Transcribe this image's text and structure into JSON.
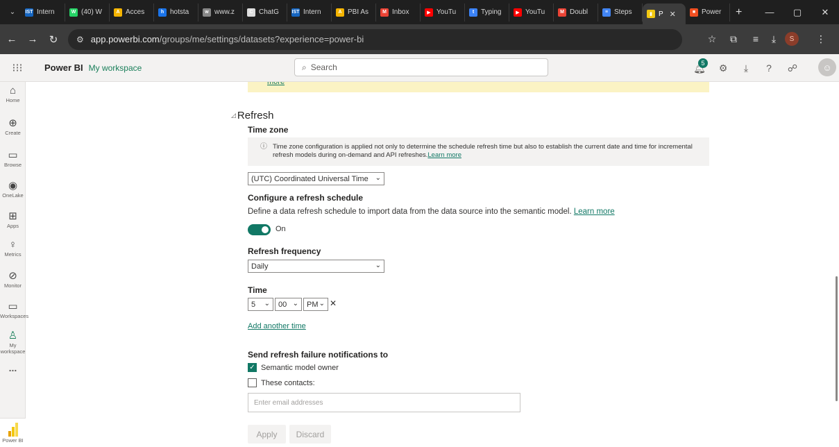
{
  "browser": {
    "tabs": [
      {
        "label": "Intern",
        "color": "#1565c0",
        "glyph": "IST"
      },
      {
        "label": "(40) W",
        "color": "#25d366",
        "glyph": "W"
      },
      {
        "label": "Acces",
        "color": "#f4b400",
        "glyph": "A"
      },
      {
        "label": "hotsta",
        "color": "#1a73e8",
        "glyph": "h"
      },
      {
        "label": "www.z",
        "color": "#888888",
        "glyph": "w"
      },
      {
        "label": "ChatG",
        "color": "#dddddd",
        "glyph": "C"
      },
      {
        "label": "Intern",
        "color": "#1565c0",
        "glyph": "IST"
      },
      {
        "label": "PBI As",
        "color": "#f4b400",
        "glyph": "A"
      },
      {
        "label": "Inbox",
        "color": "#ea4335",
        "glyph": "M"
      },
      {
        "label": "YouTu",
        "color": "#ff0000",
        "glyph": "▶"
      },
      {
        "label": "Typing",
        "color": "#3b82f6",
        "glyph": "t"
      },
      {
        "label": "YouTu",
        "color": "#ff0000",
        "glyph": "▶"
      },
      {
        "label": "Doubl",
        "color": "#ea4335",
        "glyph": "M"
      },
      {
        "label": "Steps",
        "color": "#4285f4",
        "glyph": "≡"
      },
      {
        "label": "P",
        "color": "#f2c811",
        "glyph": "▮",
        "active": true
      },
      {
        "label": "Power",
        "color": "#f25022",
        "glyph": "■"
      }
    ],
    "url_host": "app.powerbi.com",
    "url_path": "/groups/me/settings/datasets?experience=power-bi",
    "profile_initial": "S"
  },
  "header": {
    "brand": "Power BI",
    "workspace": "My workspace",
    "search_placeholder": "Search",
    "notification_count": "5"
  },
  "leftnav": {
    "items": [
      {
        "label": "Home",
        "icon": "home-icon",
        "glyph": "⌂"
      },
      {
        "label": "Create",
        "icon": "create-icon",
        "glyph": "⊕"
      },
      {
        "label": "Browse",
        "icon": "browse-icon",
        "glyph": "▭"
      },
      {
        "label": "OneLake",
        "icon": "onelake-icon",
        "glyph": "◉"
      },
      {
        "label": "Apps",
        "icon": "apps-icon",
        "glyph": "⊞"
      },
      {
        "label": "Metrics",
        "icon": "metrics-icon",
        "glyph": "♀"
      },
      {
        "label": "Monitor",
        "icon": "monitor-icon",
        "glyph": "⊘"
      },
      {
        "label": "Workspaces",
        "icon": "workspaces-icon",
        "glyph": "▭"
      },
      {
        "label": "My workspace",
        "icon": "my-workspace-icon",
        "glyph": "♙",
        "active": true
      }
    ],
    "more": "...",
    "pbi_label": "Power BI"
  },
  "content": {
    "banner_link": "more",
    "section_title": "Refresh",
    "timezone_label": "Time zone",
    "timezone_info": "Time zone configuration is applied not only to determine the schedule refresh time but also to establish the current date and time for incremental refresh models during on-demand and API refreshes.",
    "timezone_info_link": "Learn more",
    "timezone_value": "(UTC) Coordinated Universal Time",
    "schedule_label": "Configure a refresh schedule",
    "schedule_desc": "Define a data refresh schedule to import data from the data source into the semantic model.",
    "schedule_link": "Learn more",
    "toggle_label": "On",
    "frequency_label": "Refresh frequency",
    "frequency_value": "Daily",
    "time_label": "Time",
    "time_hour": "5",
    "time_minute": "00",
    "time_ampm": "PM",
    "add_time": "Add another time",
    "notify_label": "Send refresh failure notifications to",
    "owner_label": "Semantic model owner",
    "contacts_label": "These contacts:",
    "email_placeholder": "Enter email addresses",
    "apply": "Apply",
    "discard": "Discard"
  }
}
